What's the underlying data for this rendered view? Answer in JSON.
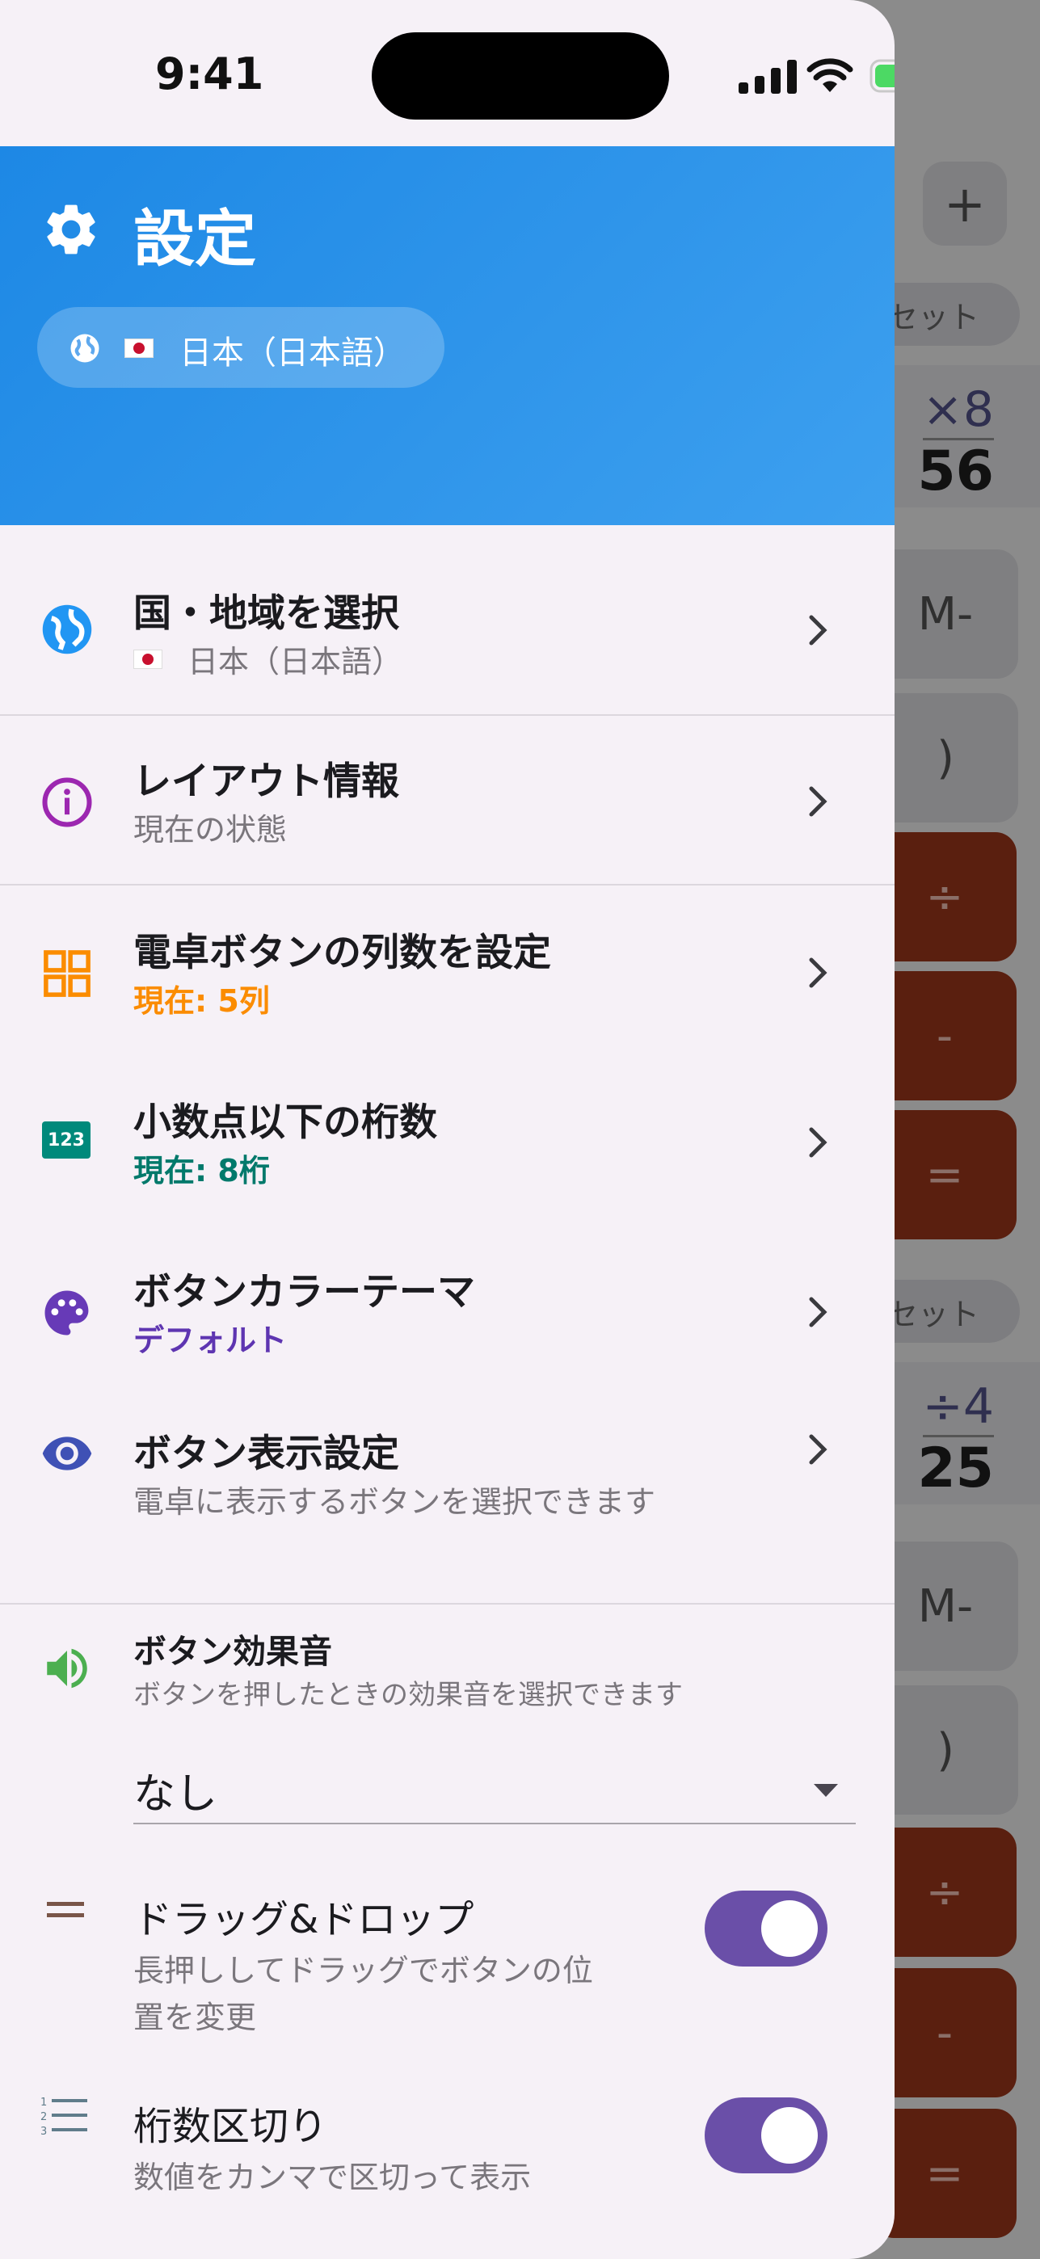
{
  "status_bar": {
    "time": "9:41"
  },
  "background_app": {
    "labels": [
      "+",
      "リセット",
      "×8",
      "56",
      "M-",
      ")",
      "÷",
      "-",
      "=",
      "リセット",
      "÷4",
      "25",
      "M-",
      ")",
      "÷",
      "-",
      "="
    ]
  },
  "drawer": {
    "header": {
      "title": "設定",
      "language_chip": "日本（日本語）"
    },
    "items": [
      {
        "title": "国・地域を選択",
        "subtitle": "日本（日本語）",
        "icon": "globe-icon",
        "color": "#2196f3"
      },
      {
        "title": "レイアウト情報",
        "subtitle": "現在の状態",
        "icon": "info-icon",
        "color": "#9c27b0"
      },
      {
        "title": "電卓ボタンの列数を設定",
        "subtitle": "現在: 5列",
        "icon": "grid-icon",
        "color": "#fb8c00"
      },
      {
        "title": "小数点以下の桁数",
        "subtitle": "現在: 8桁",
        "icon": "numbers-123-icon",
        "color": "#00897b"
      },
      {
        "title": "ボタンカラーテーマ",
        "subtitle": "デフォルト",
        "icon": "palette-icon",
        "color": "#673ab7"
      },
      {
        "title": "ボタン表示設定",
        "subtitle": "電卓に表示するボタンを選択できます",
        "icon": "eye-icon",
        "color": "#3f51b5"
      }
    ],
    "sound": {
      "title": "ボタン効果音",
      "subtitle": "ボタンを押したときの効果音を選択できます",
      "selected": "なし",
      "icon": "volume-icon",
      "color": "#4caf50"
    },
    "drag_drop": {
      "title": "ドラッグ&ドロップ",
      "subtitle_line1": "長押ししてドラッグでボタンの位",
      "subtitle_line2": "置を変更",
      "enabled": true,
      "color": "#795548"
    },
    "digit_separator": {
      "title": "桁数区切り",
      "subtitle": "数値をカンマで区切って表示",
      "enabled": true,
      "color": "#607d8b"
    }
  },
  "colors": {
    "header_blue": "#1d88e5",
    "toggle_on": "#6a4fa8",
    "calc_operator": "#5a1f0f"
  }
}
